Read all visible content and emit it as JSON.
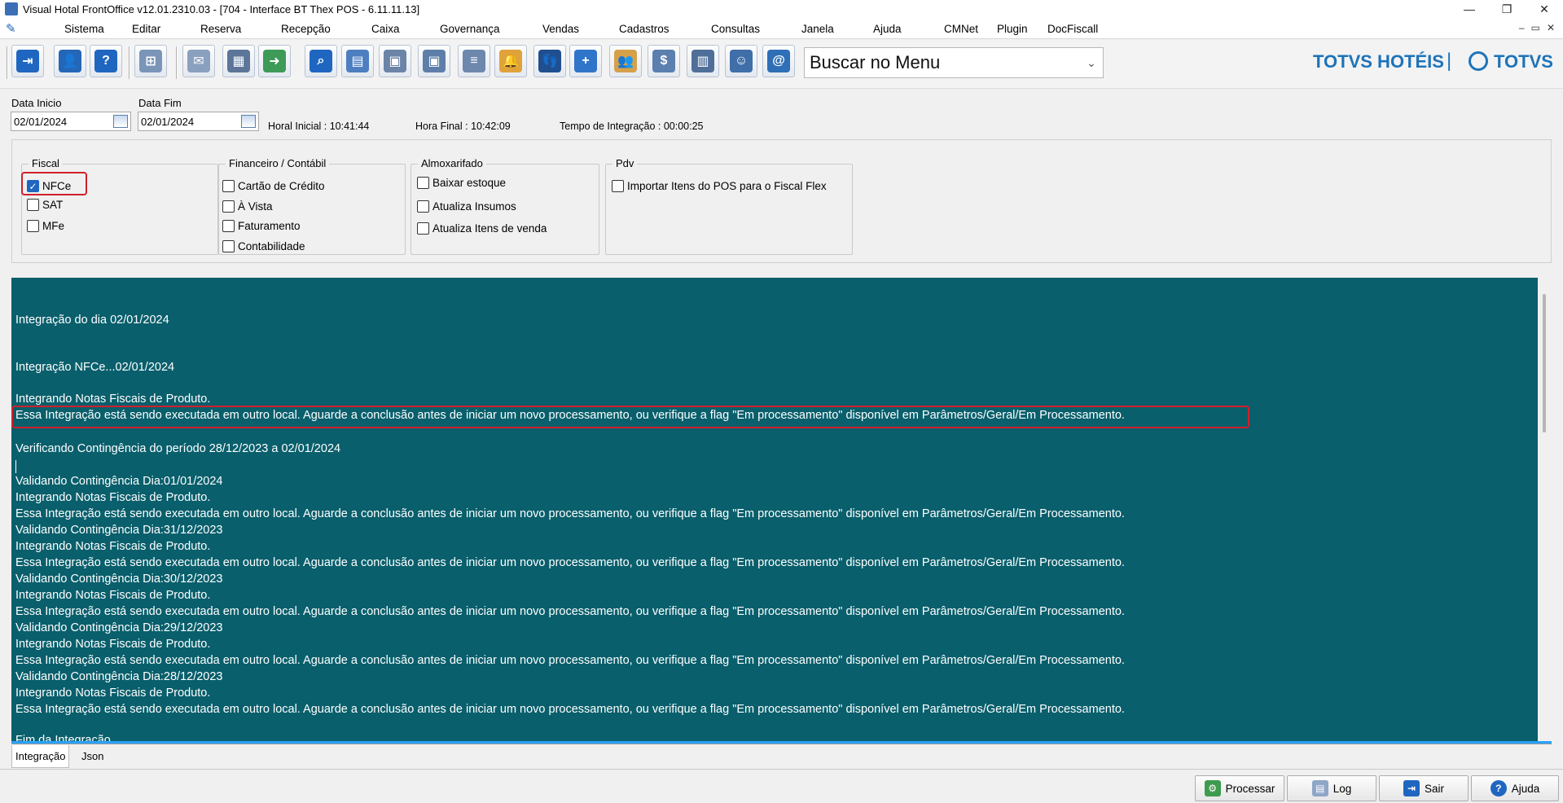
{
  "window": {
    "title": "Visual Hotal FrontOffice v12.01.2310.03 - [704 - Interface BT Thex POS - 6.11.11.13]",
    "controls": [
      "—",
      "❐",
      "✕"
    ]
  },
  "menu": {
    "items": [
      "Sistema",
      "Editar",
      "Reserva",
      "Recepção",
      "Caixa",
      "Governança",
      "Vendas",
      "Cadastros",
      "Consultas",
      "Janela",
      "Ajuda",
      "CMNet",
      "Plugin",
      "DocFiscall"
    ],
    "mdi_controls": [
      "–",
      "▭",
      "✕"
    ]
  },
  "toolbar": {
    "buttons": [
      {
        "name": "exit-icon",
        "color": "#1f66c1",
        "glyph": "⇥"
      },
      {
        "name": "user-key-icon",
        "color": "#2467b8",
        "glyph": "👤"
      },
      {
        "name": "help-icon",
        "color": "#1f66c1",
        "glyph": "?"
      },
      {
        "name": "org-chart-icon",
        "color": "#7b95b8",
        "glyph": "⊞"
      },
      {
        "name": "mail-icon",
        "color": "#8aa0bf",
        "glyph": "✉"
      },
      {
        "name": "calculator-icon",
        "color": "#5c7599",
        "glyph": "▦"
      },
      {
        "name": "mail-send-icon",
        "color": "#3d9a57",
        "glyph": "➜"
      },
      {
        "name": "search-icon",
        "color": "#1f66c1",
        "glyph": "⌕"
      },
      {
        "name": "calendar-icon",
        "color": "#4d7ec0",
        "glyph": "▤"
      },
      {
        "name": "guest-card-icon",
        "color": "#6b84a8",
        "glyph": "▣"
      },
      {
        "name": "id-card-icon",
        "color": "#5d7ea8",
        "glyph": "▣"
      },
      {
        "name": "report-icon",
        "color": "#6e88ad",
        "glyph": "≡"
      },
      {
        "name": "bell-icon",
        "color": "#e0a23a",
        "glyph": "🔔"
      },
      {
        "name": "footsteps-icon",
        "color": "#1f4f8f",
        "glyph": "👣"
      },
      {
        "name": "add-user-icon",
        "color": "#2f75c9",
        "glyph": "+"
      },
      {
        "name": "users-bell-icon",
        "color": "#d6a04a",
        "glyph": "👥"
      },
      {
        "name": "cash-register-icon",
        "color": "#5b7fae",
        "glyph": "$"
      },
      {
        "name": "pos-terminal-icon",
        "color": "#4f6f99",
        "glyph": "▥"
      },
      {
        "name": "receptionist-icon",
        "color": "#3f6ea8",
        "glyph": "☺"
      },
      {
        "name": "address-book-icon",
        "color": "#2f6fb7",
        "glyph": "@"
      }
    ],
    "search_label": "Buscar no Menu",
    "brand_left": "TOTVS HOTÉIS",
    "brand_right": "TOTVS"
  },
  "dates": {
    "start_label": "Data Inicio",
    "start_value": "02/01/2024",
    "end_label": "Data Fim",
    "end_value": "02/01/2024",
    "start_time": "Horal Inicial : 10:41:44",
    "end_time": "Hora Final : 10:42:09",
    "integration_time": "Tempo de Integração :  00:00:25"
  },
  "groups": {
    "fiscal": {
      "title": "Fiscal",
      "items": [
        {
          "label": "NFCe",
          "checked": true
        },
        {
          "label": "SAT",
          "checked": false
        },
        {
          "label": "MFe",
          "checked": false
        }
      ]
    },
    "financeiro": {
      "title": "Financeiro / Contábil",
      "items": [
        {
          "label": "Cartão de Crédito",
          "checked": false
        },
        {
          "label": "À Vista",
          "checked": false
        },
        {
          "label": "Faturamento",
          "checked": false
        },
        {
          "label": "Contabilidade",
          "checked": false
        }
      ]
    },
    "almoxarifado": {
      "title": "Almoxarifado",
      "items": [
        {
          "label": "Baixar estoque",
          "checked": false
        },
        {
          "label": "Atualiza Insumos",
          "checked": false
        },
        {
          "label": "Atualiza Itens de venda",
          "checked": false
        }
      ]
    },
    "pdv": {
      "title": "Pdv",
      "items": [
        {
          "label": "Importar Itens do POS para o Fiscal Flex",
          "checked": false
        }
      ]
    }
  },
  "log": {
    "lines": [
      "Integração do dia 02/01/2024",
      "Integração NFCe...02/01/2024",
      "Integrando Notas Fiscais de Produto.",
      "Essa Integração está sendo executada em outro local. Aguarde a conclusão antes de iniciar um novo processamento, ou verifique a flag \"Em processamento\" disponível em Parâmetros/Geral/Em Processamento.",
      "Verificando Contingência do período 28/12/2023 a 02/01/2024",
      "Validando Contingência Dia:01/01/2024",
      "Integrando Notas Fiscais de Produto.",
      "Essa Integração está sendo executada em outro local. Aguarde a conclusão antes de iniciar um novo processamento, ou verifique a flag \"Em processamento\" disponível em Parâmetros/Geral/Em Processamento.",
      "Validando Contingência Dia:31/12/2023",
      "Integrando Notas Fiscais de Produto.",
      "Essa Integração está sendo executada em outro local. Aguarde a conclusão antes de iniciar um novo processamento, ou verifique a flag \"Em processamento\" disponível em Parâmetros/Geral/Em Processamento.",
      "Validando Contingência Dia:30/12/2023",
      "Integrando Notas Fiscais de Produto.",
      "Essa Integração está sendo executada em outro local. Aguarde a conclusão antes de iniciar um novo processamento, ou verifique a flag \"Em processamento\" disponível em Parâmetros/Geral/Em Processamento.",
      "Validando Contingência Dia:29/12/2023",
      "Integrando Notas Fiscais de Produto.",
      "Essa Integração está sendo executada em outro local. Aguarde a conclusão antes de iniciar um novo processamento, ou verifique a flag \"Em processamento\" disponível em Parâmetros/Geral/Em Processamento.",
      "Validando Contingência Dia:28/12/2023",
      "Integrando Notas Fiscais de Produto.",
      "Essa Integração está sendo executada em outro local. Aguarde a conclusão antes de iniciar um novo processamento, ou verifique a flag \"Em processamento\" disponível em Parâmetros/Geral/Em Processamento.",
      "Fim da Integração"
    ]
  },
  "tabs": [
    "Integração",
    "Json"
  ],
  "buttons": {
    "processar": "Processar",
    "log": "Log",
    "sair": "Sair",
    "ajuda": "Ajuda"
  }
}
